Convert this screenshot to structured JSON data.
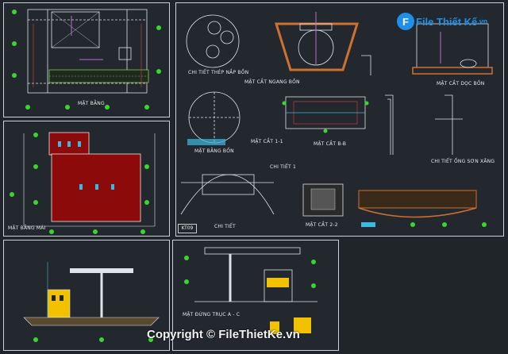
{
  "watermark": {
    "brand": "File Thiết Kế",
    "domain": ".vn",
    "badge": "F"
  },
  "copyright": "Copyright © FileThietKe.vn",
  "sheet_id": "KT09",
  "labels": {
    "mat_bang": "MẶT BẰNG",
    "mat_bang_mai": "MẶT BẰNG MÁI",
    "chi_tiet_nap_bon": "CHI TIẾT THÉP NẮP BỒN",
    "mat_cat_ngang_bon": "MẶT CẮT NGANG BỒN",
    "mat_cat_doc_bon": "MẶT CẮT DỌC BỒN",
    "mat_bang_bon": "MẶT BẰNG BỒN",
    "mat_cat_1": "MẶT CẮT 1-1",
    "mat_cat_b": "MẶT CẮT B-B",
    "chi_tiet_ong": "CHI TIẾT ỐNG SƠN XĂNG",
    "chi_tiet_1": "CHI TIẾT 1",
    "chi_tiet_2": "CHI TIẾT",
    "mat_cat_2": "MẶT CẮT 2-2",
    "mat_dung_truc": "MẶT ĐỨNG TRỤC A - C"
  }
}
